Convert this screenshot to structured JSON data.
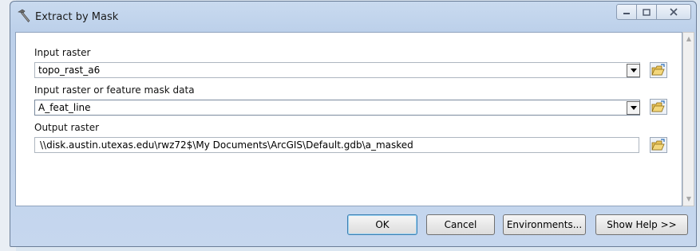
{
  "window": {
    "title": "Extract by Mask"
  },
  "fields": [
    {
      "label": "Input raster",
      "value": "topo_rast_a6"
    },
    {
      "label": "Input raster or feature mask data",
      "value": "A_feat_line"
    },
    {
      "label": "Output raster",
      "value": "\\\\disk.austin.utexas.edu\\rwz72$\\My Documents\\ArcGIS\\Default.gdb\\a_masked"
    }
  ],
  "buttons": {
    "ok": "OK",
    "cancel": "Cancel",
    "environments": "Environments...",
    "show_help": "Show Help >>"
  }
}
